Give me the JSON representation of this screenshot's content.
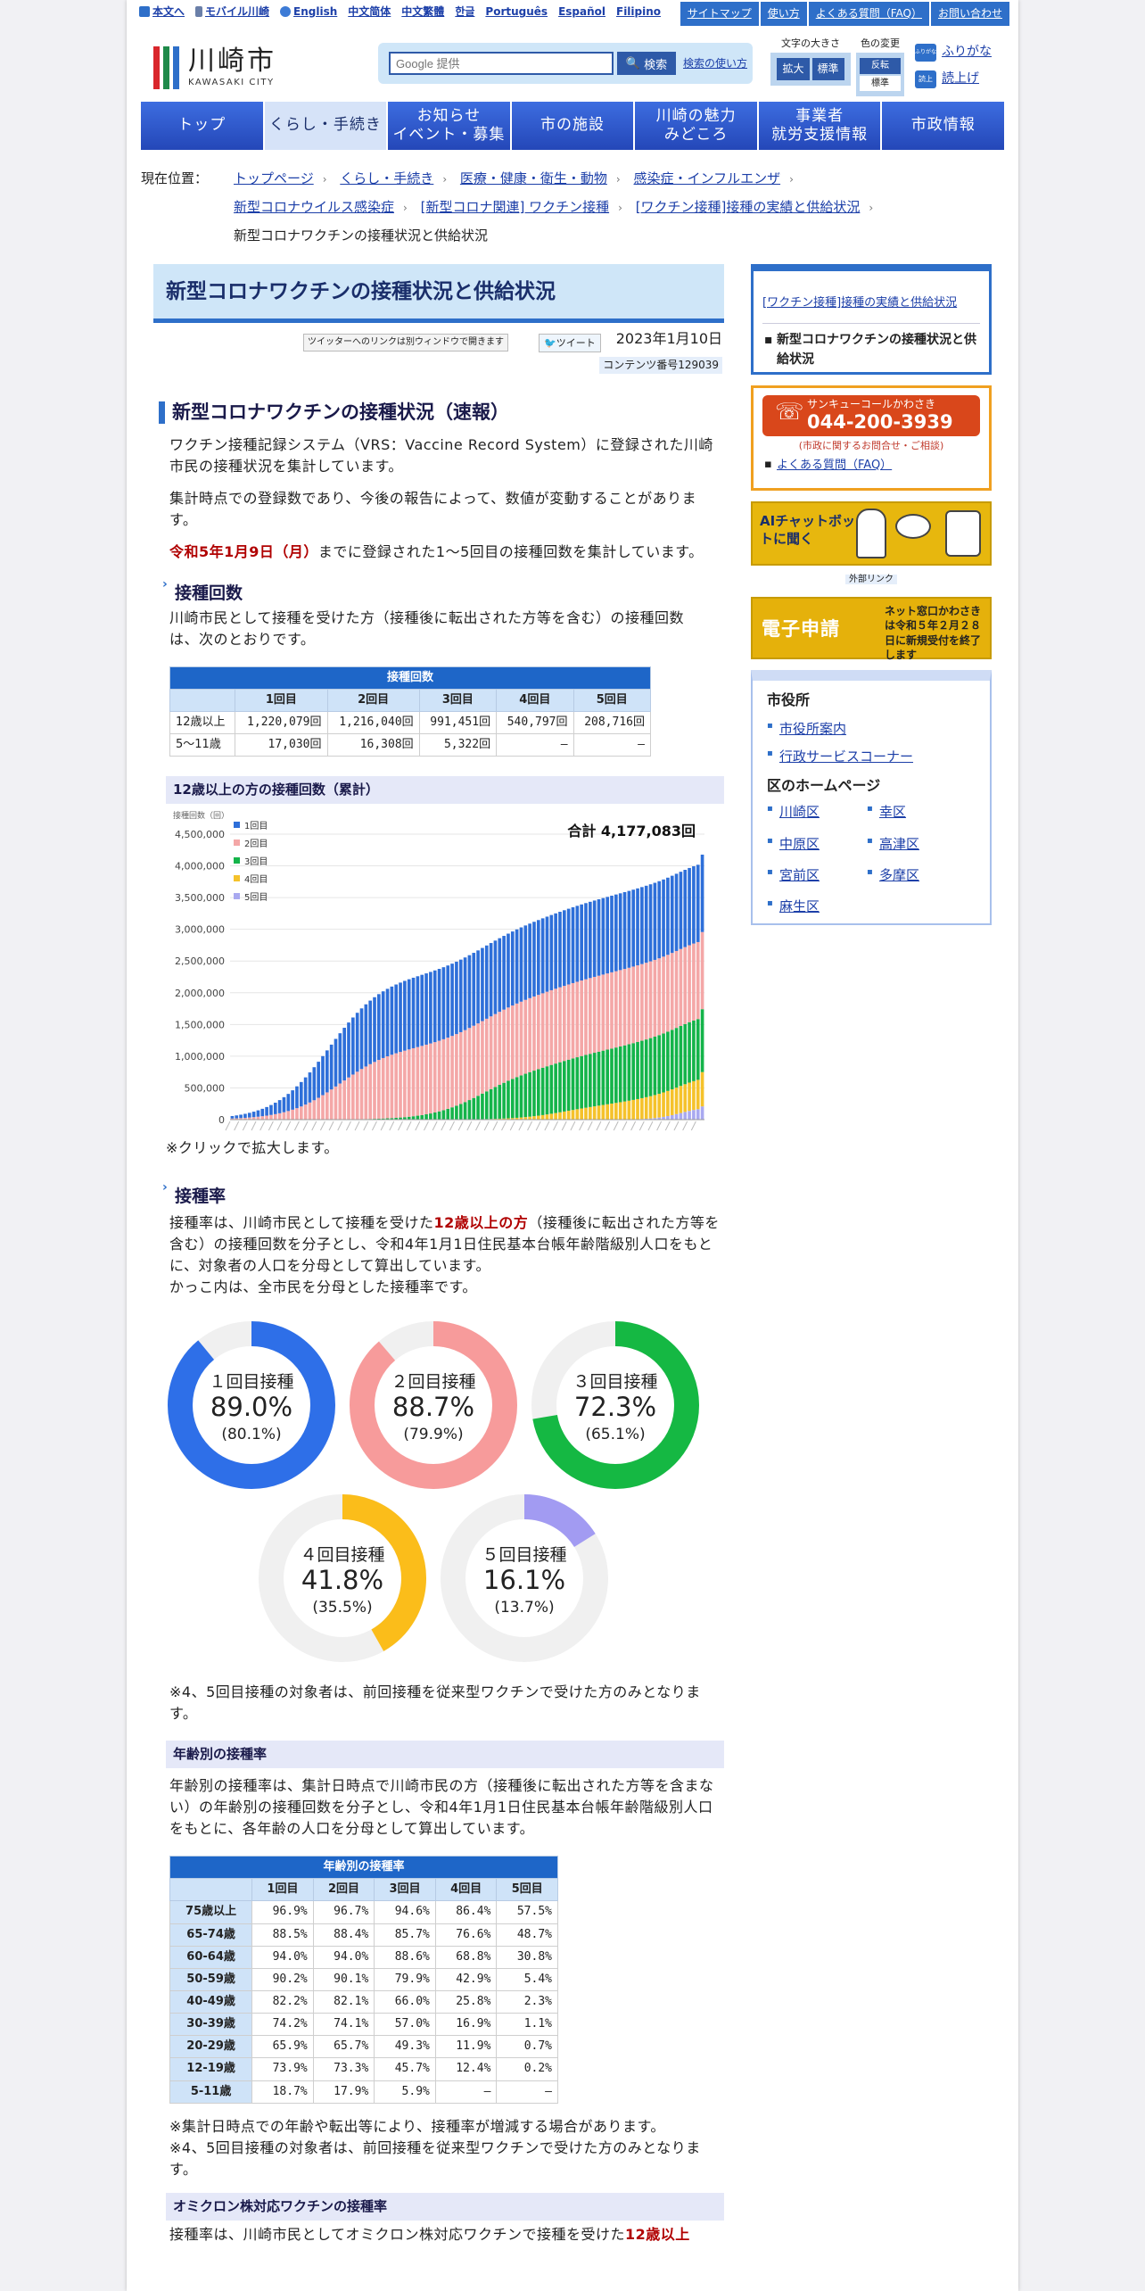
{
  "util": {
    "skip": "本文へ",
    "mobile": "モバイル川崎",
    "langs": [
      "English",
      "中文简体",
      "中文繁體",
      "한글",
      "Português",
      "Español",
      "Filipino"
    ],
    "right": [
      "サイトマップ",
      "使い方",
      "よくある質問（FAQ）",
      "お問い合わせ"
    ]
  },
  "header": {
    "logo_jp": "川崎市",
    "logo_en": "KAWASAKI CITY",
    "search_placeholder": "Google 提供",
    "search_btn": "検索",
    "search_help": "検索の使い方",
    "fontsize_label": "文字の大きさ",
    "fontsize_big": "拡大",
    "fontsize_std": "標準",
    "color_label": "色の変更",
    "color_invert": "反転",
    "color_std": "標準",
    "ruby_icon": "ふりがな",
    "ruby": "ふりがな",
    "read_icon": "読上",
    "read": "読上げ"
  },
  "gnav": [
    "トップ",
    "くらし・手続き",
    "お知らせ\nイベント・募集",
    "市の施設",
    "川崎の魅力\nみどころ",
    "事業者\n就労支援情報",
    "市政情報"
  ],
  "breadcrumb": {
    "label": "現在位置：",
    "row1": [
      "トップページ",
      "くらし・手続き",
      "医療・健康・衛生・動物",
      "感染症・インフルエンザ"
    ],
    "row2": [
      "新型コロナウイルス感染症",
      "[新型コロナ関連] ワクチン接種",
      "[ワクチン接種]接種の実績と供給状況"
    ],
    "current": "新型コロナワクチンの接種状況と供給状況"
  },
  "page": {
    "title": "新型コロナワクチンの接種状況と供給状況",
    "twitter_note": "ツイッターへのリンクは別ウィンドウで開きます",
    "tweet": "ツイート",
    "date": "2023年1月10日",
    "content_no": "コンテンツ番号129039"
  },
  "sec1": {
    "h2": "新型コロナワクチンの接種状況（速報）",
    "p1": "ワクチン接種記録システム（VRS：Vaccine Record System）に登録された川崎市民の接種状況を集計しています。",
    "p2": "集計時点での登録数であり、今後の報告によって、数値が変動することがあります。",
    "p3_red": "令和5年1月9日（月）",
    "p3_rest": "までに登録された1～5回目の接種回数を集計しています。"
  },
  "counts": {
    "h3": "接種回数",
    "p": "川崎市民として接種を受けた方（接種後に転出された方等を含む）の接種回数は、次のとおりです。",
    "caption": "接種回数",
    "headers": [
      "",
      "1回目",
      "2回目",
      "3回目",
      "4回目",
      "5回目"
    ],
    "rows": [
      [
        "12歳以上",
        "1,220,079回",
        "1,216,040回",
        "991,451回",
        "540,797回",
        "208,716回"
      ],
      [
        "5～11歳",
        "17,030回",
        "16,308回",
        "5,322回",
        "—",
        "—"
      ]
    ]
  },
  "cumchart": {
    "h4": "12歳以上の方の接種回数（累計）",
    "yunit": "接種回数（回）",
    "total": "合計 4,177,083回",
    "note": "※クリックで拡大します。"
  },
  "chart_data": {
    "type": "bar",
    "stacked": true,
    "x_count": 110,
    "ylim": [
      0,
      4500000
    ],
    "yticks": [
      "4,500,000",
      "4,000,000",
      "3,500,000",
      "3,000,000",
      "2,500,000",
      "2,000,000",
      "1,500,000",
      "1,000,000",
      "500,000",
      "0"
    ],
    "colors": {
      "d1": "#2e6fd9",
      "d2": "#f4a7a7",
      "d3": "#14b44a",
      "d4": "#f5c22b",
      "d5": "#a9a9f0"
    },
    "series": [
      {
        "name": "1回目",
        "key": "d1",
        "final": 1220079
      },
      {
        "name": "2回目",
        "key": "d2",
        "final": 1216040
      },
      {
        "name": "3回目",
        "key": "d3",
        "final": 991451
      },
      {
        "name": "4回目",
        "key": "d4",
        "final": 540797
      },
      {
        "name": "5回目",
        "key": "d5",
        "final": 208716
      }
    ]
  },
  "rate": {
    "h3": "接種率",
    "p1a": "接種率は、川崎市民として接種を受けた",
    "p1red": "12歳以上の方",
    "p1b": "（接種後に転出された方等を含む）の接種回数を分子とし、令和4年1月1日住民基本台帳年齢階級別人口をもとに、対象者の人口を分母として算出しています。",
    "p2": "かっこ内は、全市民を分母とした接種率です。",
    "donuts": [
      {
        "label": "１回目接種",
        "value": "89.0%",
        "sub": "(80.1%)",
        "pct": 89.0,
        "color": "#2e6fe8"
      },
      {
        "label": "２回目接種",
        "value": "88.7%",
        "sub": "(79.9%)",
        "pct": 88.7,
        "color": "#f79b9b"
      },
      {
        "label": "３回目接種",
        "value": "72.3%",
        "sub": "(65.1%)",
        "pct": 72.3,
        "color": "#15b843"
      },
      {
        "label": "４回目接種",
        "value": "41.8%",
        "sub": "(35.5%)",
        "pct": 41.8,
        "color": "#fbbd1a"
      },
      {
        "label": "５回目接種",
        "value": "16.1%",
        "sub": "(13.7%)",
        "pct": 16.1,
        "color": "#a29bf2"
      }
    ],
    "note": "※4、5回目接種の対象者は、前回接種を従来型ワクチンで受けた方のみとなります。"
  },
  "age": {
    "h4": "年齢別の接種率",
    "p": "年齢別の接種率は、集計日時点で川崎市民の方（接種後に転出された方等を含まない）の年齢別の接種回数を分子とし、令和4年1月1日住民基本台帳年齢階級別人口をもとに、各年齢の人口を分母として算出しています。",
    "caption": "年齢別の接種率",
    "headers": [
      "",
      "1回目",
      "2回目",
      "3回目",
      "4回目",
      "5回目"
    ],
    "rows": [
      [
        "75歳以上",
        "96.9%",
        "96.7%",
        "94.6%",
        "86.4%",
        "57.5%"
      ],
      [
        "65-74歳",
        "88.5%",
        "88.4%",
        "85.7%",
        "76.6%",
        "48.7%"
      ],
      [
        "60-64歳",
        "94.0%",
        "94.0%",
        "88.6%",
        "68.8%",
        "30.8%"
      ],
      [
        "50-59歳",
        "90.2%",
        "90.1%",
        "79.9%",
        "42.9%",
        "5.4%"
      ],
      [
        "40-49歳",
        "82.2%",
        "82.1%",
        "66.0%",
        "25.8%",
        "2.3%"
      ],
      [
        "30-39歳",
        "74.2%",
        "74.1%",
        "57.0%",
        "16.9%",
        "1.1%"
      ],
      [
        "20-29歳",
        "65.9%",
        "65.7%",
        "49.3%",
        "11.9%",
        "0.7%"
      ],
      [
        "12-19歳",
        "73.9%",
        "73.3%",
        "45.7%",
        "12.4%",
        "0.2%"
      ],
      [
        "5-11歳",
        "18.7%",
        "17.9%",
        "5.9%",
        "—",
        "—"
      ]
    ],
    "note1": "※集計日時点での年齢や転出等により、接種率が増減する場合があります。",
    "note2": "※4、5回目接種の対象者は、前回接種を従来型ワクチンで受けた方のみとなります。"
  },
  "omicron": {
    "h4": "オミクロン株対応ワクチンの接種率",
    "p_a": "接種率は、川崎市民としてオミクロン株対応ワクチンで接種を受けた",
    "p_red": "12歳以上"
  },
  "side": {
    "link1": "[ワクチン接種]接種の実績と供給状況",
    "current": "新型コロナワクチンの接種状況と供給状況",
    "call_title": "サンキューコールかわさき",
    "call_phone": "044-200-3939",
    "call_sub": "(市政に関するお問合せ・ご相談)",
    "faq": "よくある質問（FAQ）",
    "ai_text": "AIチャットボットに聞く",
    "ext": "外部リンク",
    "shinsei_label": "電子申請",
    "shinsei_text": "ネット窓口かわさきは令和５年２月２８日に新規受付を終了します",
    "cityhall_h": "市役所",
    "cityhall": [
      "市役所案内",
      "行政サービスコーナー"
    ],
    "ward_h": "区のホームページ",
    "wards": [
      "川崎区",
      "幸区",
      "中原区",
      "高津区",
      "宮前区",
      "多摩区",
      "麻生区"
    ]
  }
}
